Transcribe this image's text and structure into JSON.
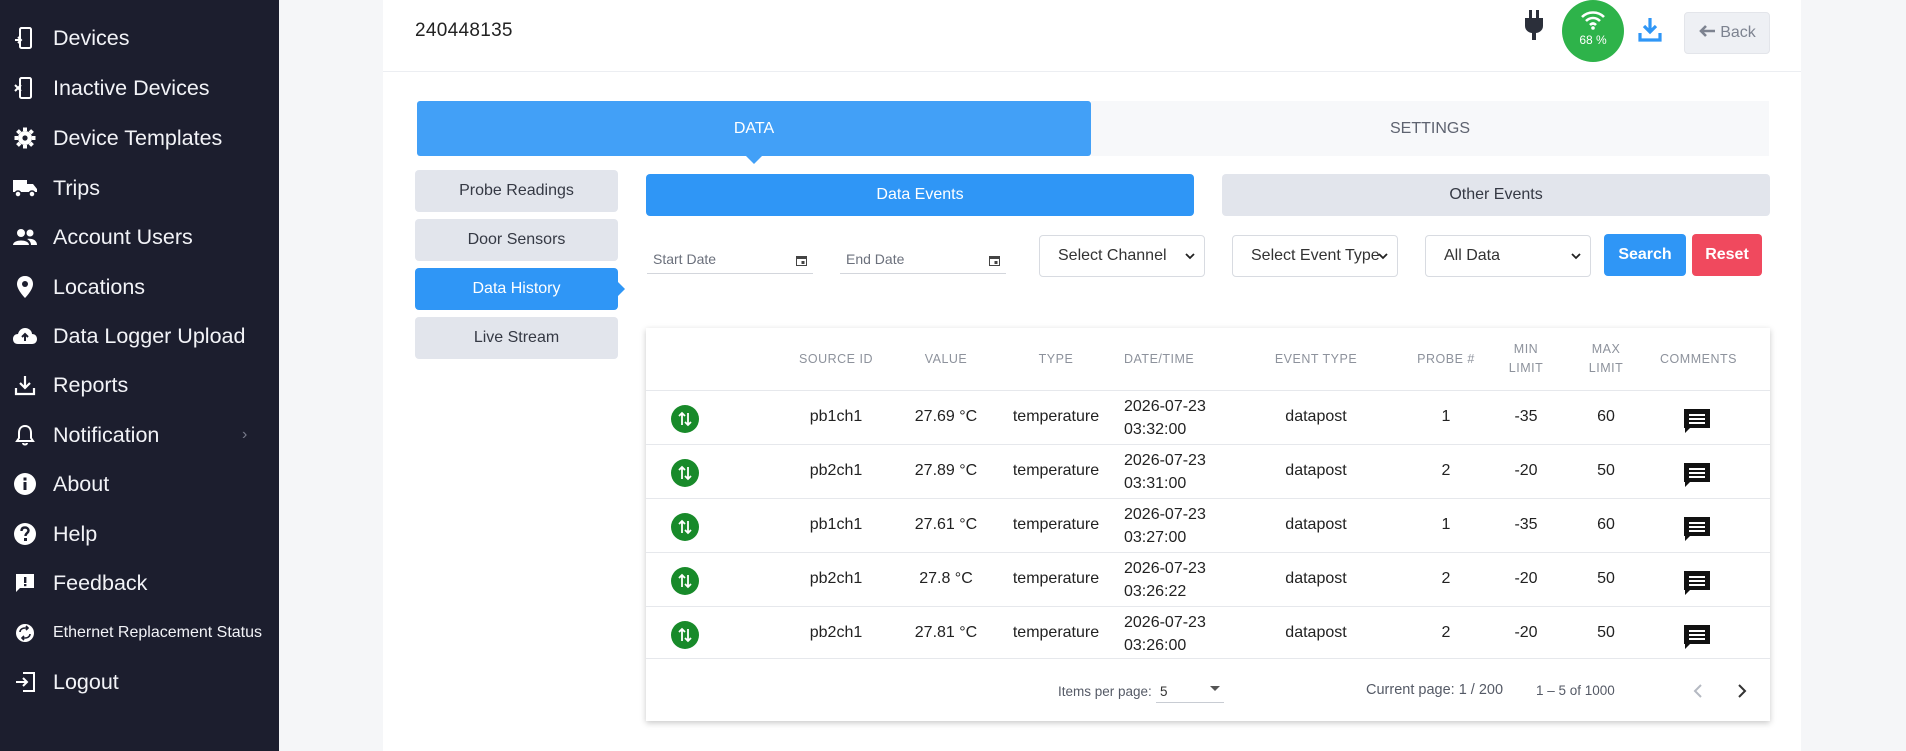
{
  "sidebar": {
    "items": [
      {
        "label": "Devices",
        "icon": "device-icon"
      },
      {
        "label": "Inactive Devices",
        "icon": "inactive-device-icon"
      },
      {
        "label": "Device Templates",
        "icon": "gear-icon"
      },
      {
        "label": "Trips",
        "icon": "truck-icon"
      },
      {
        "label": "Account Users",
        "icon": "users-icon"
      },
      {
        "label": "Locations",
        "icon": "map-pin-icon"
      },
      {
        "label": "Data Logger Upload",
        "icon": "cloud-upload-icon"
      },
      {
        "label": "Reports",
        "icon": "download-icon"
      },
      {
        "label": "Notification",
        "icon": "bell-icon"
      },
      {
        "label": "About",
        "icon": "info-icon"
      },
      {
        "label": "Help",
        "icon": "help-icon"
      },
      {
        "label": "Feedback",
        "icon": "feedback-icon"
      },
      {
        "label": "Ethernet Replacement Status",
        "icon": "sync-icon"
      },
      {
        "label": "Logout",
        "icon": "logout-icon"
      }
    ]
  },
  "header": {
    "device_id": "240448135",
    "signal_percent": "68 %",
    "back_label": "Back"
  },
  "tabs": {
    "data": "DATA",
    "settings": "SETTINGS"
  },
  "subnav": [
    "Probe Readings",
    "Door Sensors",
    "Data History",
    "Live Stream"
  ],
  "event_tabs": {
    "data_events": "Data Events",
    "other_events": "Other Events"
  },
  "filters": {
    "start_date_placeholder": "Start Date",
    "end_date_placeholder": "End Date",
    "channel": "Select Channel",
    "event_type": "Select Event Type",
    "data_scope": "All Data",
    "search_label": "Search",
    "reset_label": "Reset"
  },
  "table": {
    "headers": {
      "source_id": "SOURCE ID",
      "value": "VALUE",
      "type": "TYPE",
      "datetime": "DATE/TIME",
      "event_type": "EVENT TYPE",
      "probe": "PROBE #",
      "min_1": "MIN",
      "min_2": "LIMIT",
      "max_1": "MAX",
      "max_2": "LIMIT",
      "comments": "COMMENTS"
    },
    "rows": [
      {
        "source_id": "pb1ch1",
        "value": "27.69 °C",
        "type": "temperature",
        "date": "2026-07-23",
        "time": "03:32:00",
        "event_type": "datapost",
        "probe": "1",
        "min": "-35",
        "max": "60"
      },
      {
        "source_id": "pb2ch1",
        "value": "27.89 °C",
        "type": "temperature",
        "date": "2026-07-23",
        "time": "03:31:00",
        "event_type": "datapost",
        "probe": "2",
        "min": "-20",
        "max": "50"
      },
      {
        "source_id": "pb1ch1",
        "value": "27.61 °C",
        "type": "temperature",
        "date": "2026-07-23",
        "time": "03:27:00",
        "event_type": "datapost",
        "probe": "1",
        "min": "-35",
        "max": "60"
      },
      {
        "source_id": "pb2ch1",
        "value": "27.8 °C",
        "type": "temperature",
        "date": "2026-07-23",
        "time": "03:26:22",
        "event_type": "datapost",
        "probe": "2",
        "min": "-20",
        "max": "50"
      },
      {
        "source_id": "pb2ch1",
        "value": "27.81 °C",
        "type": "temperature",
        "date": "2026-07-23",
        "time": "03:26:00",
        "event_type": "datapost",
        "probe": "2",
        "min": "-20",
        "max": "50"
      }
    ]
  },
  "pagination": {
    "items_per_page_label": "Items per page:",
    "items_per_page": "5",
    "current_page": "Current page: 1 / 200",
    "range": "1 – 5 of 1000"
  },
  "colors": {
    "sidebar_bg": "#1c1e2e",
    "primary": "#2f96f6",
    "tab_active": "#42a0f7",
    "danger": "#f0495e",
    "signal": "#2eb34a",
    "status_ok": "#188a2a"
  }
}
